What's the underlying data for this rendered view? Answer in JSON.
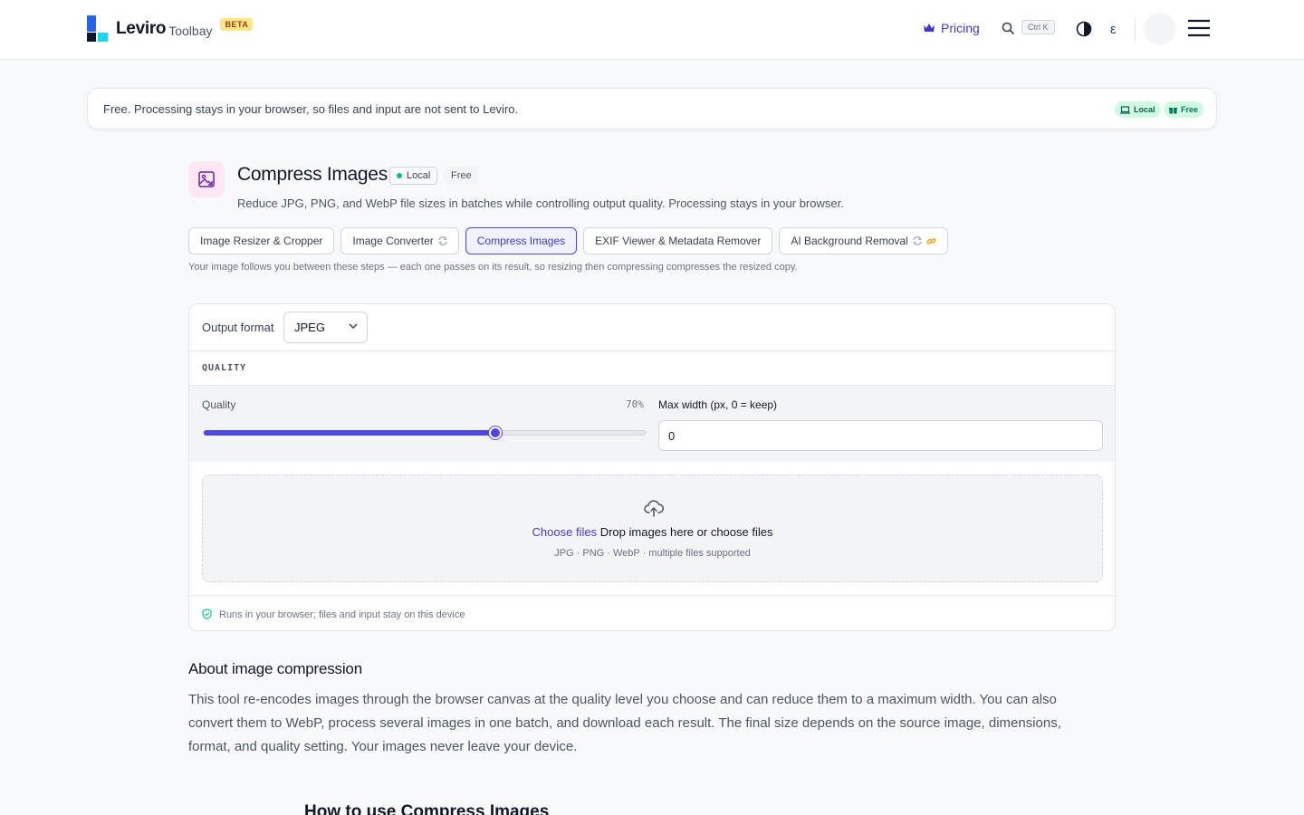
{
  "header": {
    "brand": "Leviro",
    "brand_sub": "Toolbay",
    "beta": "BETA",
    "pricing": "Pricing",
    "shortcut": "Ctrl K",
    "lang": "ε"
  },
  "notice": {
    "text": "Free. Processing stays in your browser, so files and input are not sent to Leviro.",
    "pill_local": "Local",
    "pill_free": "Free"
  },
  "tool": {
    "title": "Compress Images",
    "badge_local": "Local",
    "badge_free": "Free",
    "description": "Reduce JPG, PNG, and WebP file sizes in batches while controlling output quality. Processing stays in your browser."
  },
  "tabs": [
    {
      "label": "Image Resizer & Cropper"
    },
    {
      "label": "Image Converter"
    },
    {
      "label": "Compress Images"
    },
    {
      "label": "EXIF Viewer & Metadata Remover"
    },
    {
      "label": "AI Background Removal"
    }
  ],
  "tabs_note": "Your image follows you between these steps — each one passes on its result, so resizing then compressing compresses the resized copy.",
  "card": {
    "format_label": "Output format",
    "format_value": "JPEG",
    "section": "QUALITY",
    "quality_label": "Quality",
    "quality_value": "70%",
    "quality_fraction": 0.66,
    "maxwidth_label": "Max width (px, 0 = keep)",
    "maxwidth_value": "0",
    "drop_link": "Choose files",
    "drop_text": "Drop images here or choose files",
    "drop_sub": "JPG · PNG · WebP · multiple files supported",
    "footer": "Runs in your browser; files and input stay on this device"
  },
  "about": {
    "title": "About image compression",
    "body": "This tool re-encodes images through the browser canvas at the quality level you choose and can reduce them to a maximum width. You can also convert them to WebP, process several images in one batch, and download each result. The final size depends on the source image, dimensions, format, and quality setting. Your images never leave your device."
  },
  "howto": "How to use Compress Images",
  "colors": {
    "accent": "#4f46e5",
    "brand_blue": "#2563eb",
    "brand_cyan": "#22d3ee",
    "success": "#10b981"
  }
}
